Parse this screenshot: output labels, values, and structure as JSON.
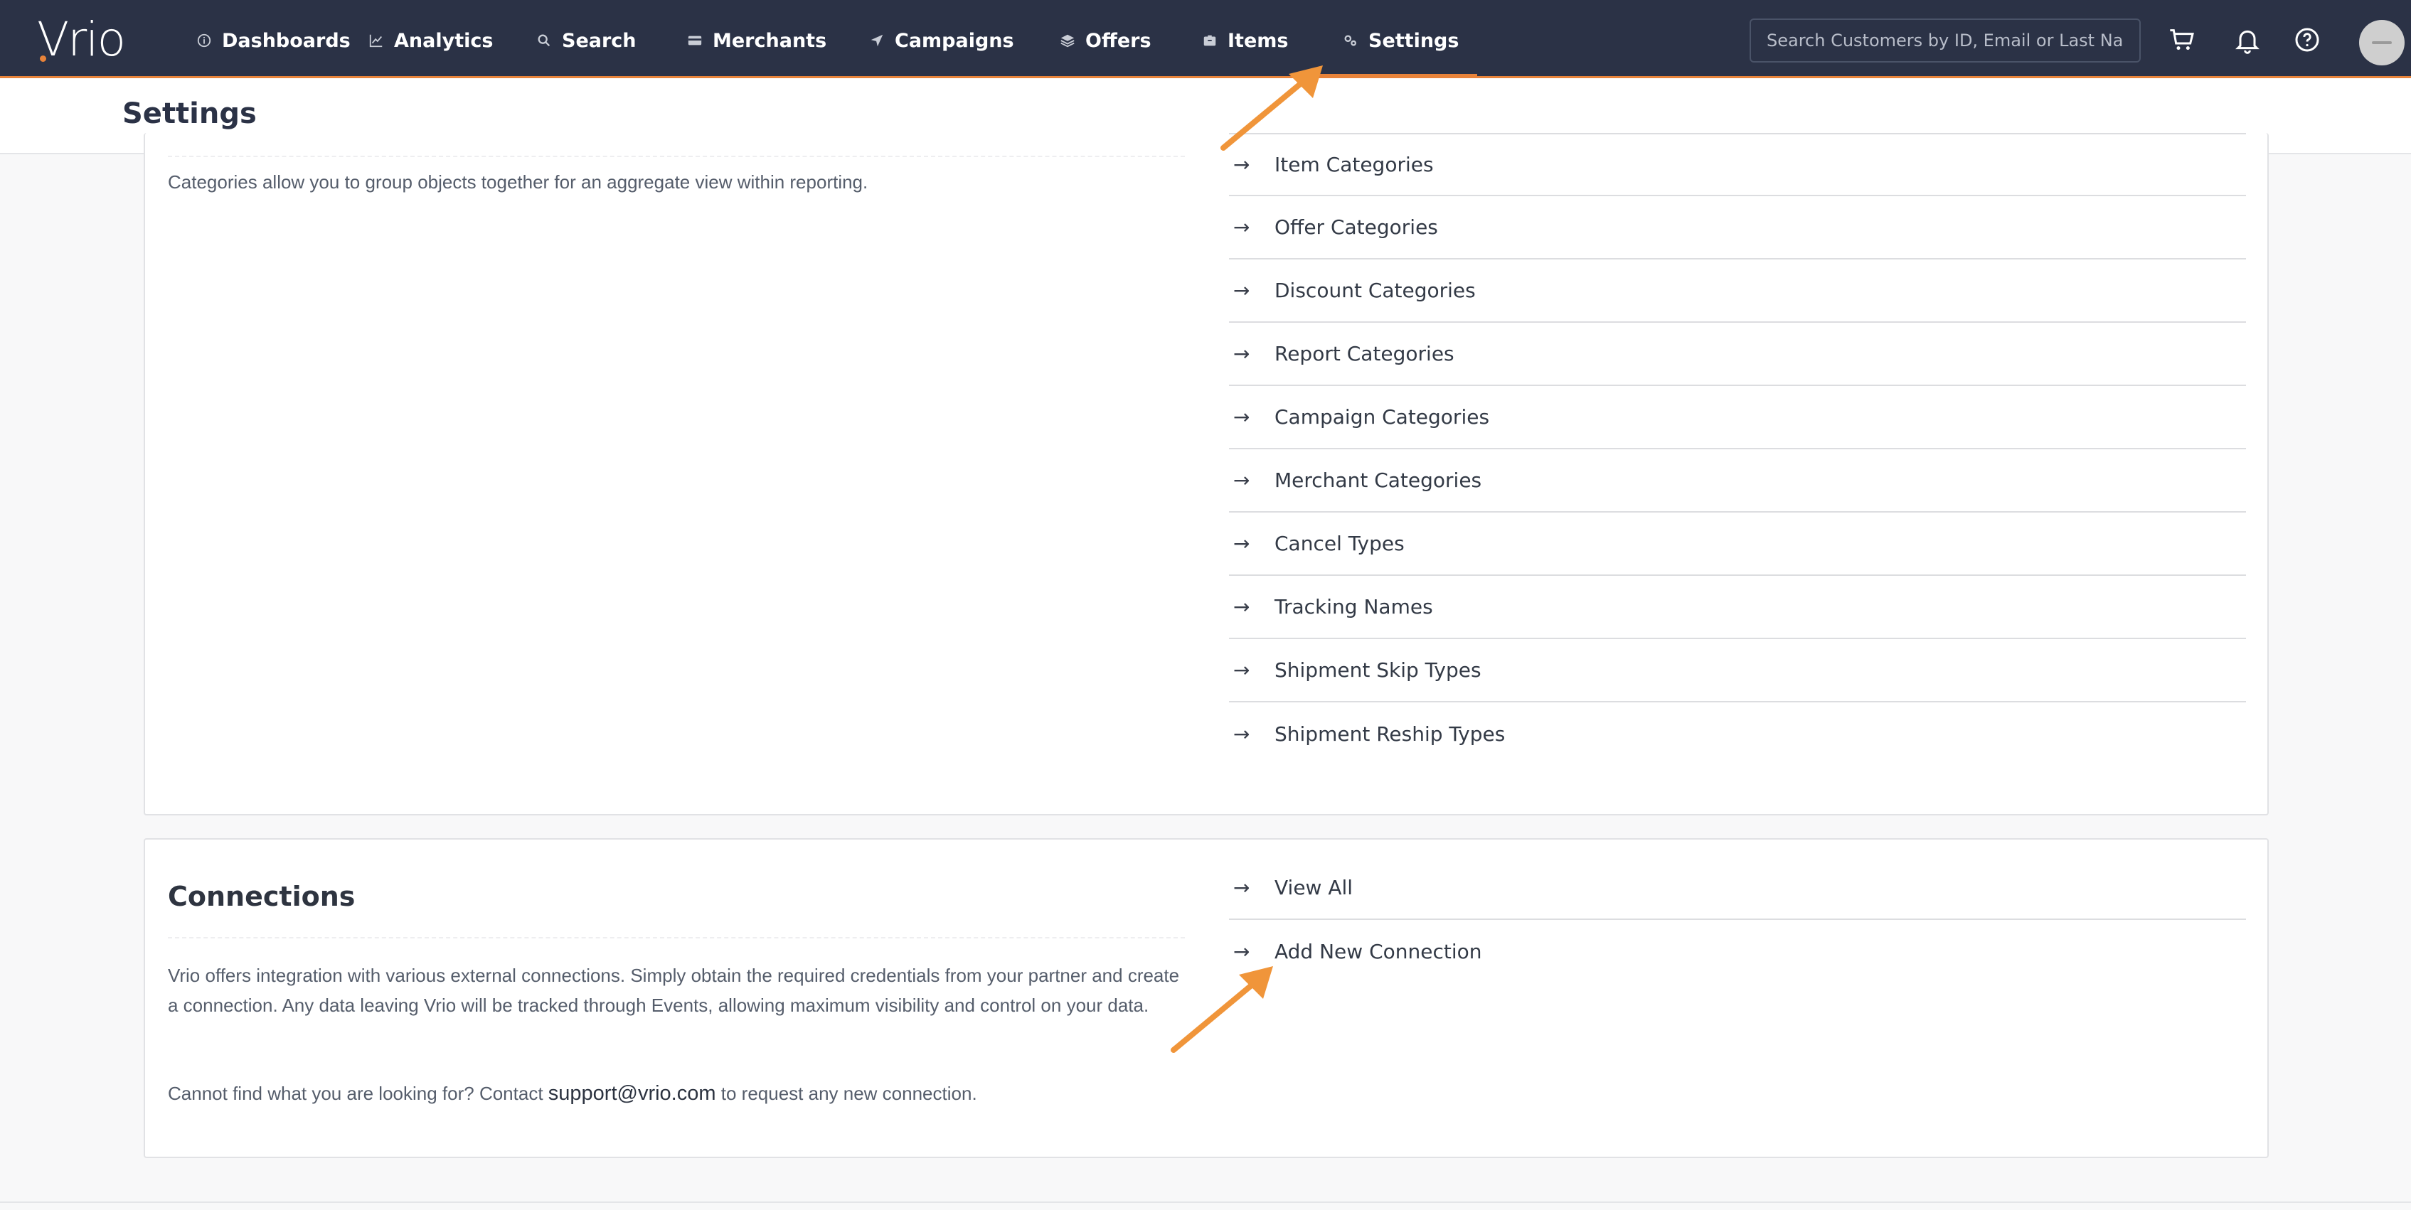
{
  "app": {
    "logo": "Vrio"
  },
  "nav": {
    "items": [
      {
        "label": "Dashboards",
        "icon": "info-circle-icon"
      },
      {
        "label": "Analytics",
        "icon": "chart-line-icon"
      },
      {
        "label": "Search",
        "icon": "search-icon"
      },
      {
        "label": "Merchants",
        "icon": "credit-card-icon"
      },
      {
        "label": "Campaigns",
        "icon": "paper-plane-icon"
      },
      {
        "label": "Offers",
        "icon": "layers-icon"
      },
      {
        "label": "Items",
        "icon": "box-icon"
      },
      {
        "label": "Settings",
        "icon": "gears-icon"
      }
    ],
    "active": "Settings",
    "search_placeholder": "Search Customers by ID, Email or Last Name",
    "accent_color": "#e8833a",
    "bar_color": "#2b3246"
  },
  "header": {
    "title": "Settings"
  },
  "categories": {
    "description": "Categories allow you to group objects together for an aggregate view within reporting.",
    "links": [
      "Item Categories",
      "Offer Categories",
      "Discount Categories",
      "Report Categories",
      "Campaign Categories",
      "Merchant Categories",
      "Cancel Types",
      "Tracking Names",
      "Shipment Skip Types",
      "Shipment Reship Types"
    ]
  },
  "connections": {
    "title": "Connections",
    "description": "Vrio offers integration with various external connections. Simply obtain the required credentials from your partner and create a connection. Any data leaving Vrio will be tracked through Events, allowing maximum visibility and control on your data.",
    "contact_prefix": "Cannot find what you are looking for? Contact",
    "contact_email": "support@vrio.com",
    "contact_suffix": "to request any new connection.",
    "links": [
      "View All",
      "Add New Connection"
    ]
  },
  "link_arrow": "→",
  "annotation_color": "#f0953a"
}
